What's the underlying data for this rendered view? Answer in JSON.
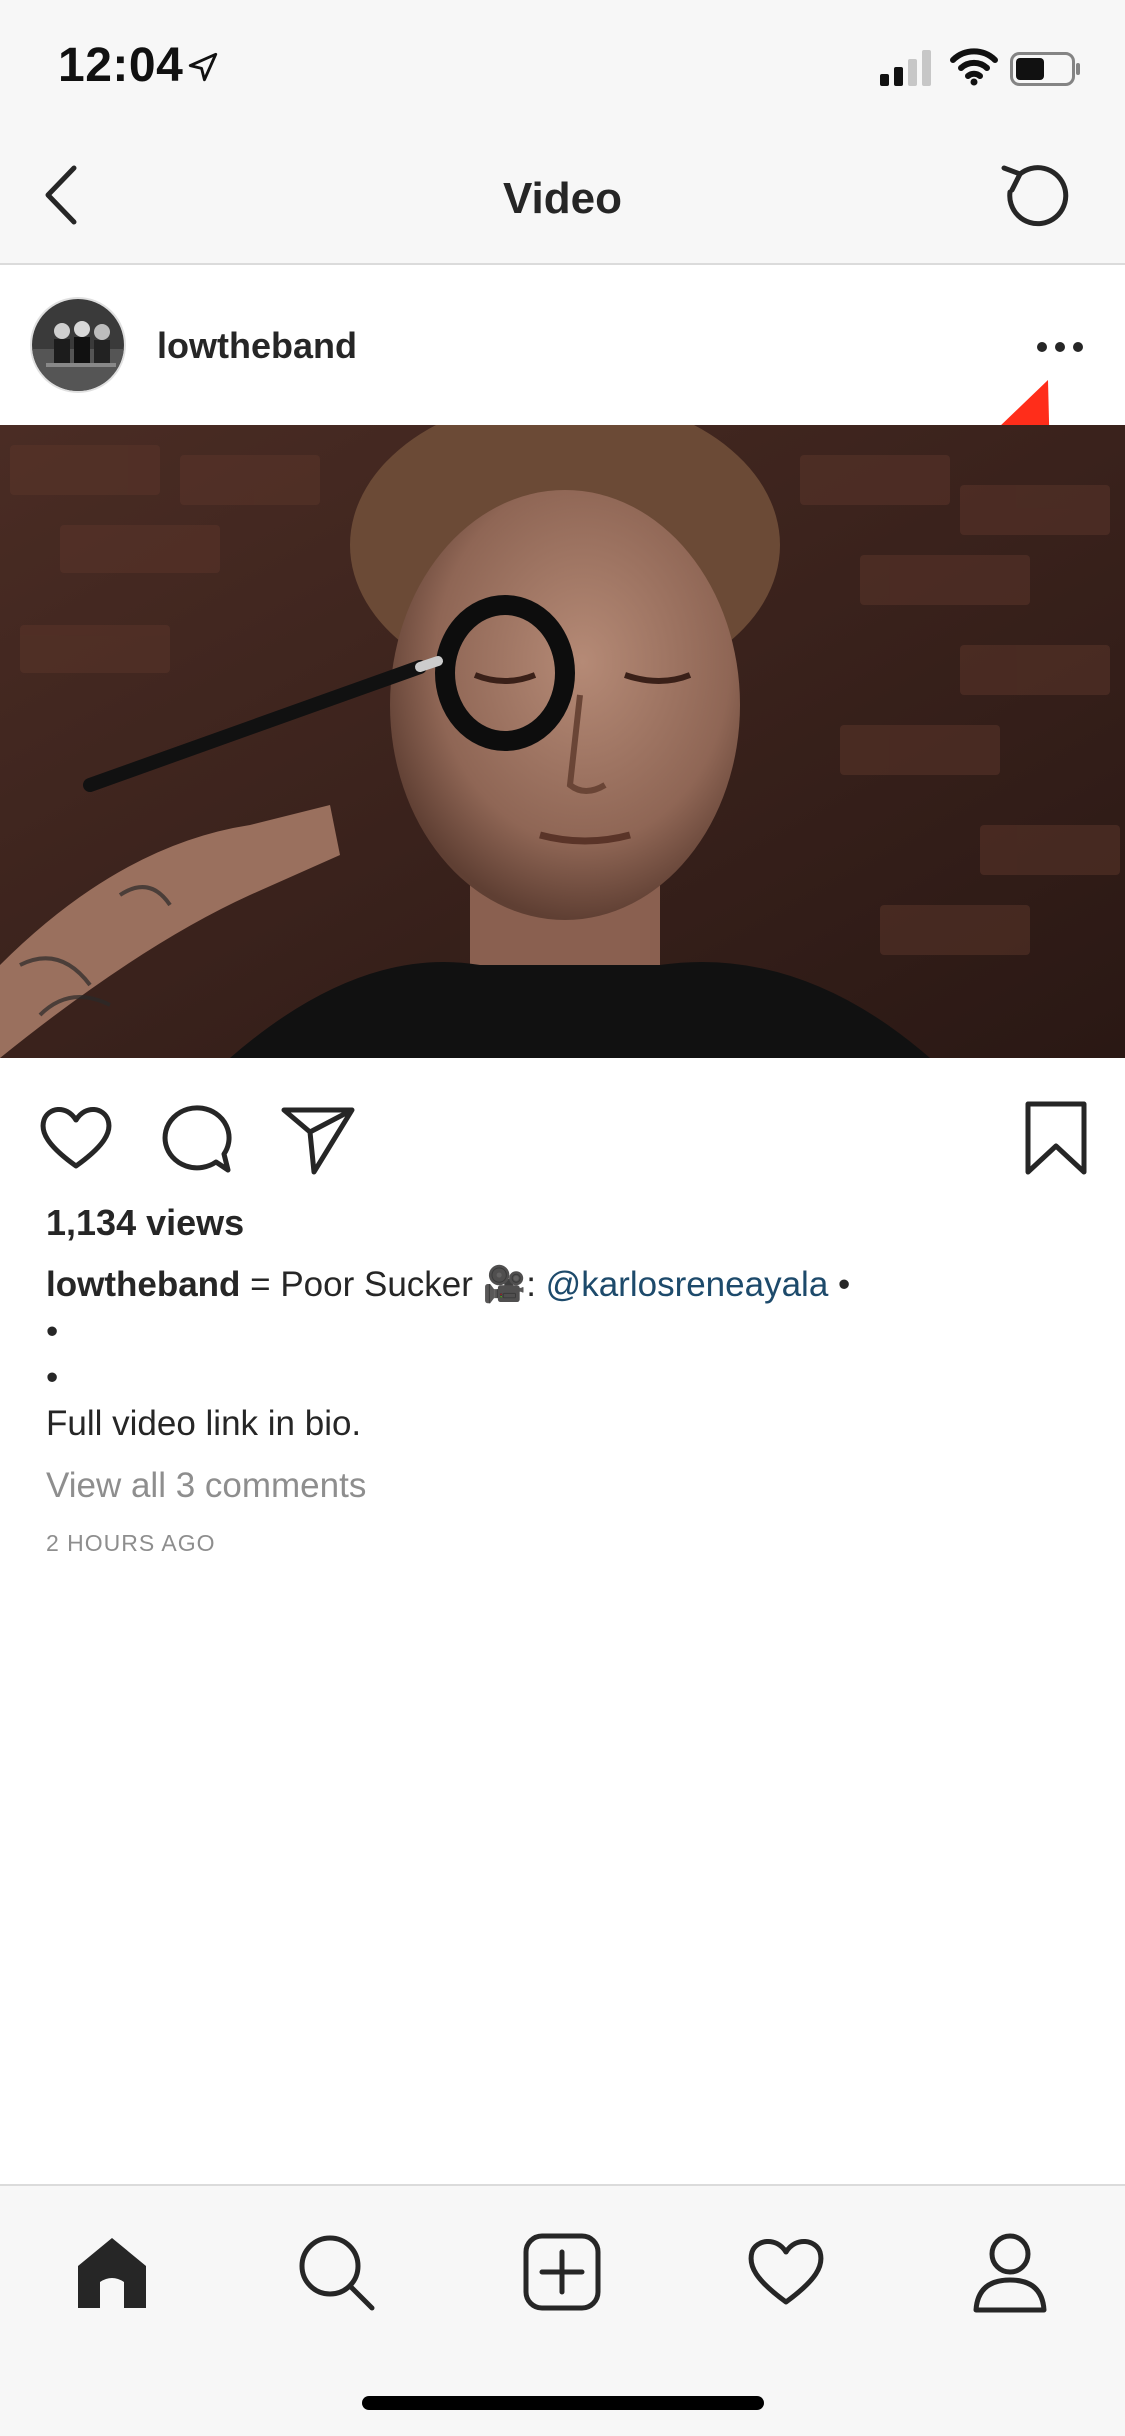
{
  "status_bar": {
    "time": "12:04",
    "icons": [
      "location-arrow-icon",
      "cellular-signal-icon",
      "wifi-icon",
      "battery-icon"
    ]
  },
  "nav": {
    "title": "Video",
    "back_icon": "chevron-left-icon",
    "refresh_icon": "refresh-icon"
  },
  "post": {
    "username": "lowtheband",
    "more_icon": "more-dots-icon",
    "annotation": "red-arrow-pointing-to-more-button",
    "video_alt": "man with eyes closed having a black circle painted around his eye with a brush"
  },
  "actions": {
    "icons": [
      "heart-icon",
      "comment-icon",
      "share-icon",
      "bookmark-icon"
    ]
  },
  "content": {
    "views": "1,134 views",
    "caption_user": "lowtheband",
    "caption_text": " = Poor Sucker 🎥: ",
    "caption_mention": "@karlosreneayala",
    "caption_tail": " •",
    "bullet_1": "•",
    "bullet_2": "•",
    "full_video": "Full video link in bio.",
    "view_comments": "View all 3 comments",
    "timestamp": "2 HOURS AGO"
  },
  "tab_bar": {
    "icons": [
      "home-icon",
      "search-icon",
      "new-post-icon",
      "activity-heart-icon",
      "profile-icon"
    ]
  },
  "colors": {
    "mention": "#1d4a6b",
    "secondary_text": "#8e8e8e",
    "annotation": "#ff2d1a"
  }
}
